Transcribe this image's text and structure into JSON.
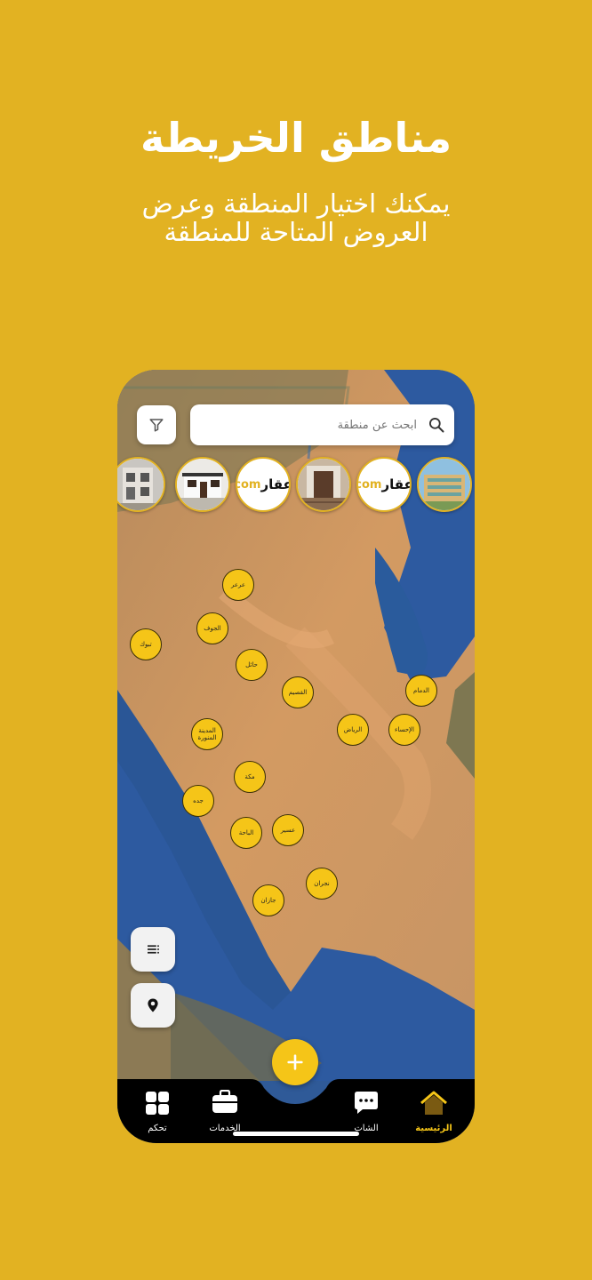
{
  "promo": {
    "title": "مناطق الخريطة",
    "subtitle_line1": "يمكنك اختيار المنطقة  وعرض",
    "subtitle_line2": "العروض المتاحة للمنطقة"
  },
  "search": {
    "placeholder": "ابحث عن منطقة"
  },
  "stories": [
    {
      "kind": "photo",
      "icon": "building-photo"
    },
    {
      "kind": "photo",
      "icon": "villa-photo"
    },
    {
      "kind": "logo",
      "text_ar": "عقار",
      "text_en": "com"
    },
    {
      "kind": "photo",
      "icon": "entrance-photo"
    },
    {
      "kind": "logo",
      "text_ar": "عقار",
      "text_en": "com"
    },
    {
      "kind": "photo",
      "icon": "apartment-photo"
    }
  ],
  "regions": [
    "عرعر",
    "الجوف",
    "تبوك",
    "حائل",
    "القصيم",
    "الدمام",
    "الرياض",
    "الإحساء",
    "المدينة المنورة",
    "مكة",
    "جده",
    "الباحة",
    "عسير",
    "نجران",
    "جازان"
  ],
  "tabs": {
    "home": "الرئيسية",
    "chat": "الشات",
    "services": "الخدمات",
    "control": "تحكم"
  },
  "colors": {
    "brand": "#E2B222",
    "pin": "#F5C518",
    "tabbar": "#000000"
  }
}
